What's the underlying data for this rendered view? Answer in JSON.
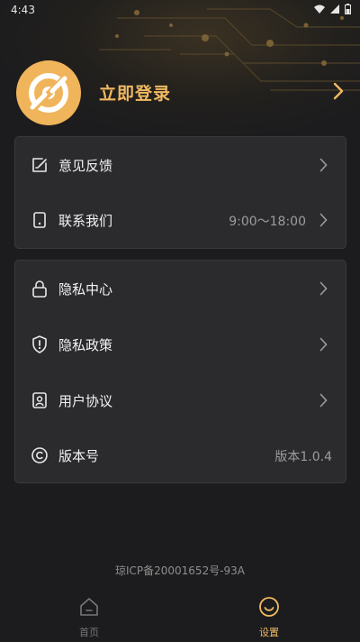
{
  "status_bar": {
    "time": "4:43"
  },
  "profile": {
    "login_label": "立即登录"
  },
  "menu_group_1": [
    {
      "label": "意见反馈",
      "value": "",
      "icon": "feedback-edit-icon"
    },
    {
      "label": "联系我们",
      "value": "9:00～18:00",
      "icon": "phone-icon"
    }
  ],
  "menu_group_2": [
    {
      "label": "隐私中心",
      "value": "",
      "icon": "lock-icon"
    },
    {
      "label": "隐私政策",
      "value": "",
      "icon": "shield-exclamation-icon"
    },
    {
      "label": "用户协议",
      "value": "",
      "icon": "user-badge-icon"
    },
    {
      "label": "版本号",
      "value": "版本1.0.4",
      "icon": "copyright-icon"
    }
  ],
  "footer": {
    "icp": "琼ICP备20001652号-93A"
  },
  "tabbar": {
    "tabs": [
      {
        "label": "首页",
        "icon": "home-icon",
        "active": false
      },
      {
        "label": "设置",
        "icon": "smile-icon",
        "active": true
      }
    ]
  },
  "colors": {
    "accent": "#f1b962",
    "background": "#1c1c1e",
    "card": "#2b2b2e"
  }
}
